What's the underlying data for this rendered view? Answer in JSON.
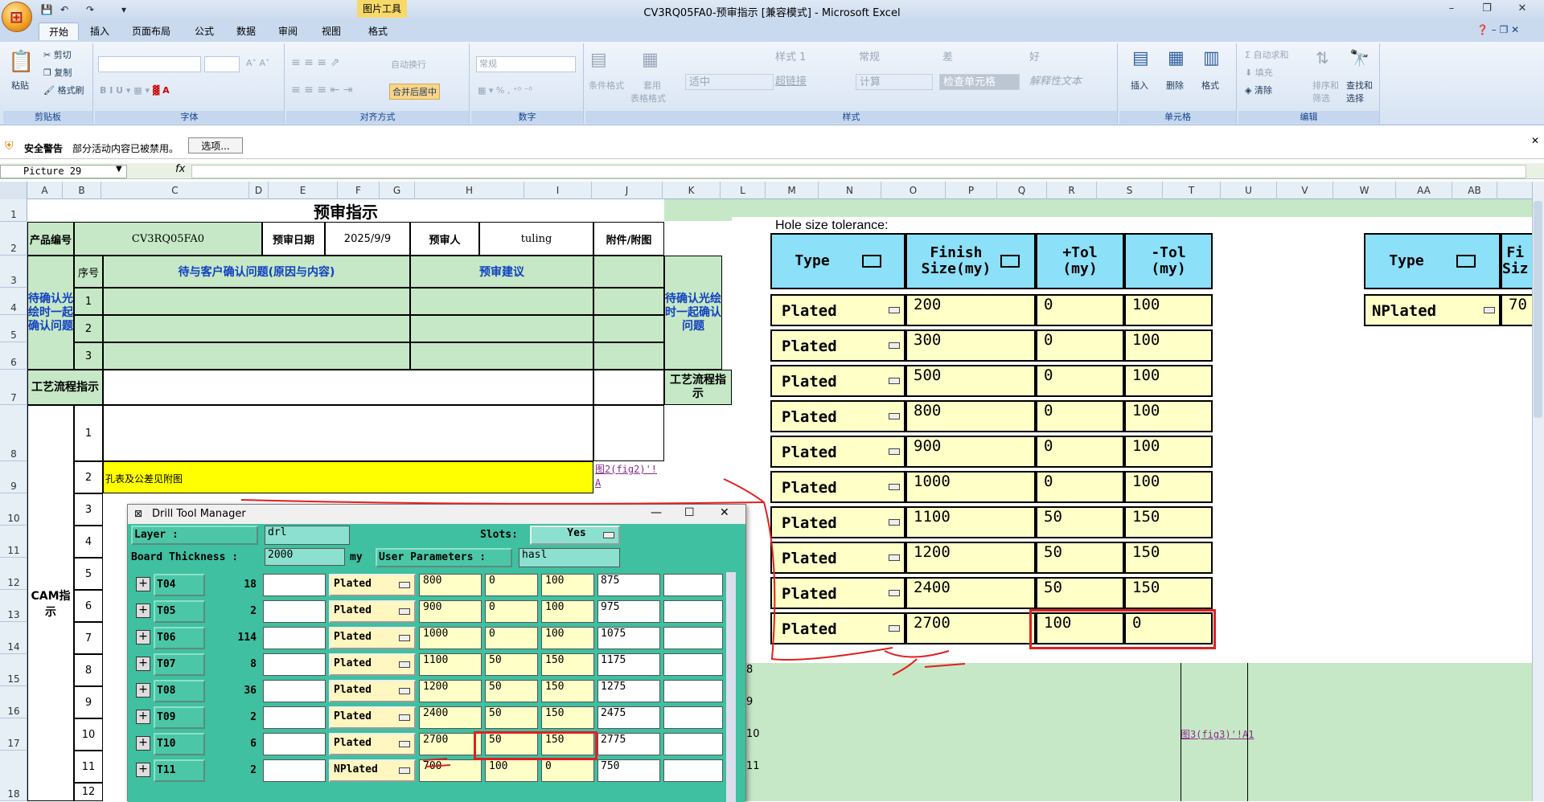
{
  "window": {
    "title": "CV3RQ05FA0-预审指示  [兼容模式] - Microsoft Excel",
    "picture_tools": "图片工具"
  },
  "tabs": [
    "开始",
    "插入",
    "页面布局",
    "公式",
    "数据",
    "审阅",
    "视图",
    "格式"
  ],
  "ribbon": {
    "clipboard": {
      "label": "剪贴板",
      "paste": "粘贴",
      "cut": "剪切",
      "copy": "复制",
      "format_painter": "格式刷"
    },
    "font": {
      "label": "字体"
    },
    "alignment": {
      "label": "对齐方式",
      "wrap": "自动换行",
      "merge": "合并后居中"
    },
    "number": {
      "label": "数字",
      "format": "常规"
    },
    "styles": {
      "label": "样式",
      "cond": "条件格式",
      "table": "套用",
      "table2": "表格格式",
      "cells": [
        "适中",
        "样式 1",
        "常规",
        "差",
        "好",
        "超链接",
        "计算",
        "检查单元格",
        "解释性文本"
      ]
    },
    "cells": {
      "label": "单元格",
      "insert": "插入",
      "delete": "删除",
      "format": "格式"
    },
    "editing": {
      "label": "编辑",
      "autosum": "自动求和",
      "fill": "填充",
      "clear": "清除",
      "sort": "排序和",
      "sort2": "筛选",
      "find": "查找和",
      "find2": "选择"
    }
  },
  "security": {
    "title": "安全警告",
    "message": "部分活动内容已被禁用。",
    "options": "选项..."
  },
  "formula_bar": {
    "name_box": "Picture 29",
    "fx": "fx"
  },
  "columns": [
    "A",
    "B",
    "C",
    "D",
    "E",
    "F",
    "G",
    "H",
    "I",
    "J",
    "K",
    "L",
    "M",
    "N",
    "O",
    "P",
    "Q",
    "R",
    "S",
    "T",
    "U",
    "V",
    "W",
    "AA",
    "AB"
  ],
  "rows": [
    "1",
    "2",
    "3",
    "4",
    "5",
    "6",
    "7",
    "8",
    "9",
    "10",
    "11",
    "12",
    "13",
    "14",
    "15",
    "16",
    "17",
    "18"
  ],
  "sheet": {
    "title": "预审指示",
    "product_no_label": "产品编号",
    "product_no": "CV3RQ05FA0",
    "review_date_label": "预审日期",
    "review_date": "2025/9/9",
    "reviewer_label": "预审人",
    "reviewer": "tuling",
    "attachment_label": "附件/附图",
    "seq_label": "序号",
    "issue_label": "待与客户确认问题(原因与内容)",
    "suggest_label": "预审建议",
    "pending_label": "待确认光绘时一起确认问题",
    "seq": [
      "1",
      "2",
      "3"
    ],
    "process_label": "工艺流程指示",
    "process_label_right": "工艺流程指示",
    "cam_label": "CAM指示",
    "cam_seq": [
      "1",
      "2",
      "3",
      "4",
      "5",
      "6",
      "7",
      "8",
      "9",
      "10",
      "11",
      "12"
    ],
    "row9_text": "孔表及公差见附图",
    "row9_link": "图2(fig2)'!A",
    "row17_link": "图3(fig3)'!A1",
    "right_row_nums": [
      "8",
      "9",
      "10",
      "11"
    ]
  },
  "drill": {
    "title": "Drill Tool Manager",
    "layer_label": "Layer          :",
    "layer": "drl",
    "slots_label": "Slots:",
    "slots": "Yes",
    "thickness_label": "Board Thickness :",
    "thickness": "2000",
    "thickness_unit": "my",
    "user_params_label": "User Parameters :",
    "user_params": "hasl",
    "rows": [
      {
        "tool": "T04",
        "count": "18",
        "type": "Plated",
        "finish": "800",
        "ptol": "0",
        "mtol": "100",
        "drill": "875"
      },
      {
        "tool": "T05",
        "count": "2",
        "type": "Plated",
        "finish": "900",
        "ptol": "0",
        "mtol": "100",
        "drill": "975"
      },
      {
        "tool": "T06",
        "count": "114",
        "type": "Plated",
        "finish": "1000",
        "ptol": "0",
        "mtol": "100",
        "drill": "1075"
      },
      {
        "tool": "T07",
        "count": "8",
        "type": "Plated",
        "finish": "1100",
        "ptol": "50",
        "mtol": "150",
        "drill": "1175"
      },
      {
        "tool": "T08",
        "count": "36",
        "type": "Plated",
        "finish": "1200",
        "ptol": "50",
        "mtol": "150",
        "drill": "1275"
      },
      {
        "tool": "T09",
        "count": "2",
        "type": "Plated",
        "finish": "2400",
        "ptol": "50",
        "mtol": "150",
        "drill": "2475"
      },
      {
        "tool": "T10",
        "count": "6",
        "type": "Plated",
        "finish": "2700",
        "ptol": "50",
        "mtol": "150",
        "drill": "2775"
      },
      {
        "tool": "T11",
        "count": "2",
        "type": "NPlated",
        "finish": "700",
        "ptol": "100",
        "mtol": "0",
        "drill": "750"
      }
    ]
  },
  "hole": {
    "caption": "Hole size tolerance:",
    "headers": {
      "type": "Type",
      "finish": "Finish\nSize(my)",
      "ptol": "+Tol\n(my)",
      "mtol": "-Tol\n(my)"
    },
    "rows": [
      {
        "type": "Plated",
        "finish": "200",
        "ptol": "0",
        "mtol": "100"
      },
      {
        "type": "Plated",
        "finish": "300",
        "ptol": "0",
        "mtol": "100"
      },
      {
        "type": "Plated",
        "finish": "500",
        "ptol": "0",
        "mtol": "100"
      },
      {
        "type": "Plated",
        "finish": "800",
        "ptol": "0",
        "mtol": "100"
      },
      {
        "type": "Plated",
        "finish": "900",
        "ptol": "0",
        "mtol": "100"
      },
      {
        "type": "Plated",
        "finish": "1000",
        "ptol": "0",
        "mtol": "100"
      },
      {
        "type": "Plated",
        "finish": "1100",
        "ptol": "50",
        "mtol": "150"
      },
      {
        "type": "Plated",
        "finish": "1200",
        "ptol": "50",
        "mtol": "150"
      },
      {
        "type": "Plated",
        "finish": "2400",
        "ptol": "50",
        "mtol": "150"
      },
      {
        "type": "Plated",
        "finish": "2700",
        "ptol": "100",
        "mtol": "0"
      }
    ],
    "second": {
      "type_header": "Type",
      "finish_header": "Fi\nSiz",
      "type": "NPlated",
      "finish": "70"
    }
  },
  "colors": {
    "accent_red": "#e02020",
    "sheet_green": "#c6e8c6",
    "teal": "#3fc0a0",
    "cyan": "#8ce0f8",
    "yellow": "#ffff00"
  }
}
